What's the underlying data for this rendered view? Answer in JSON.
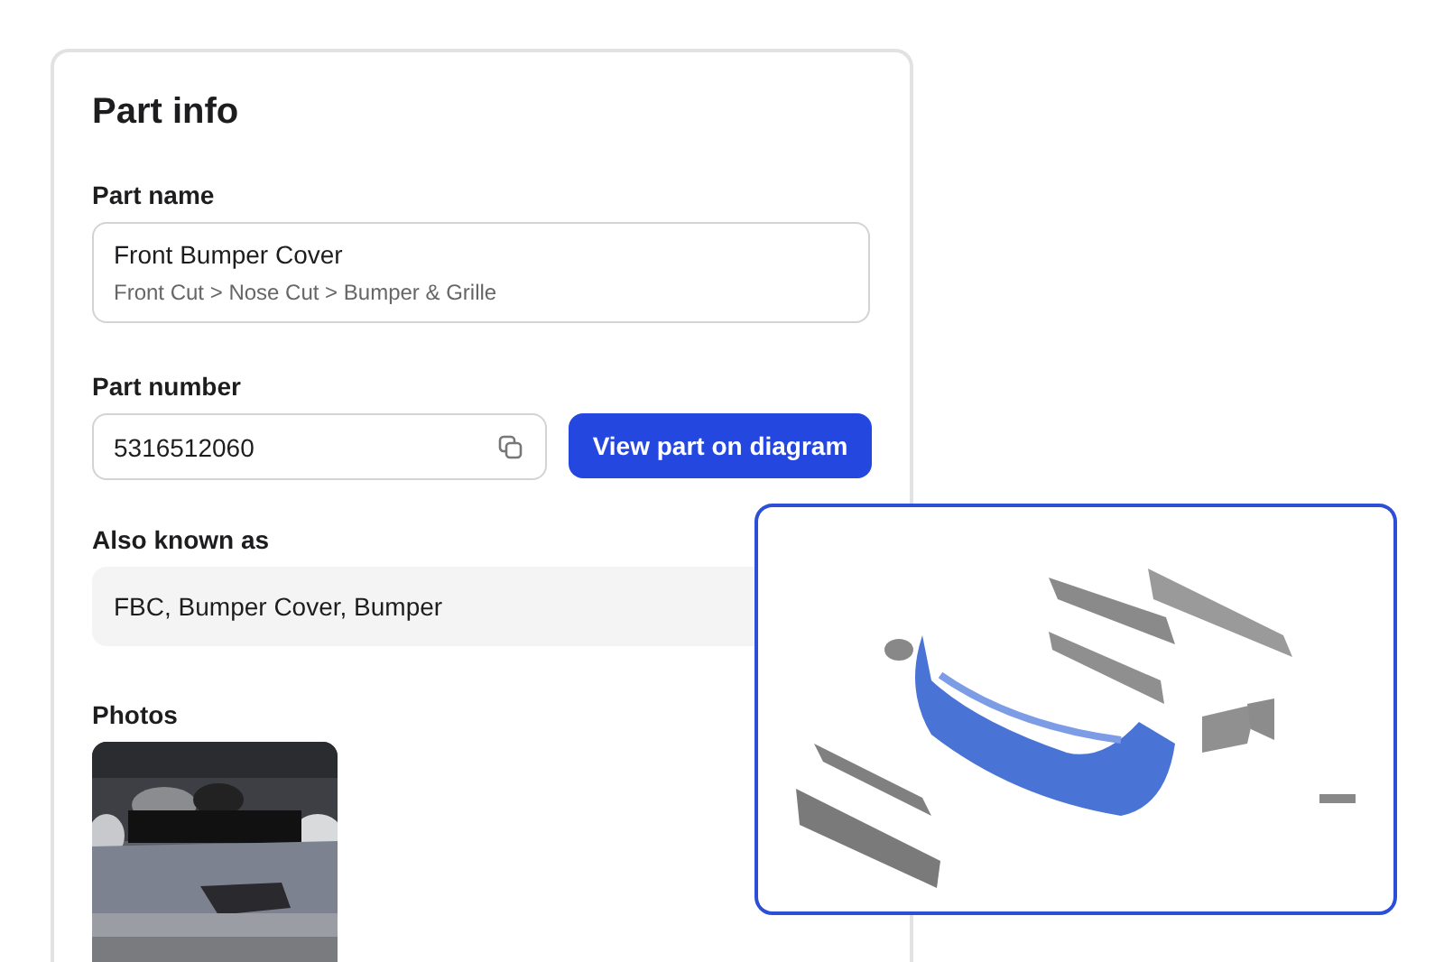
{
  "panel": {
    "title": "Part info"
  },
  "part_name": {
    "label": "Part name",
    "value": "Front Bumper Cover",
    "path": "Front Cut > Nose Cut > Bumper & Grille"
  },
  "part_number": {
    "label": "Part number",
    "value": "5316512060",
    "button": "View part on diagram"
  },
  "also_known_as": {
    "label": "Also known as",
    "value": "FBC, Bumper Cover, Bumper"
  },
  "photos": {
    "label": "Photos"
  }
}
